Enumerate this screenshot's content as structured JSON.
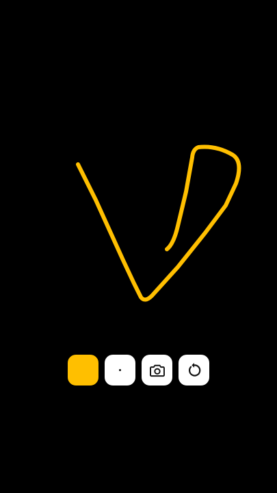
{
  "canvas": {
    "background": "#000000"
  },
  "drawing": {
    "stroke_color": "#FFBF00"
  },
  "toolbar": {
    "buttons": [
      {
        "name": "color-picker",
        "icon": "color-swatch",
        "color": "#FFBF00"
      },
      {
        "name": "brush-size",
        "icon": "dot-icon"
      },
      {
        "name": "screenshot",
        "icon": "camera-icon"
      },
      {
        "name": "undo",
        "icon": "undo-icon"
      }
    ]
  }
}
